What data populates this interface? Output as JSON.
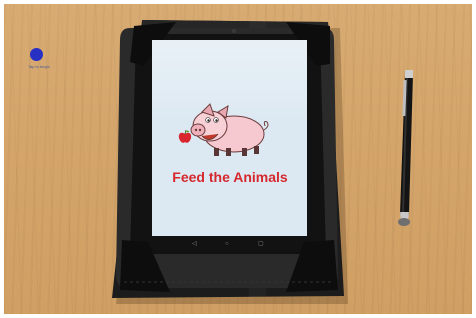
{
  "app": {
    "title": "Feed the Animals",
    "dot_caption": "Tap to begin"
  },
  "nav": {
    "back_icon": "◁",
    "home_icon": "○",
    "recents_icon": "▢"
  },
  "colors": {
    "title": "#d6282f",
    "dot": "#2830c4",
    "screen": "#dde9f2",
    "case": "#1c1c1c"
  }
}
